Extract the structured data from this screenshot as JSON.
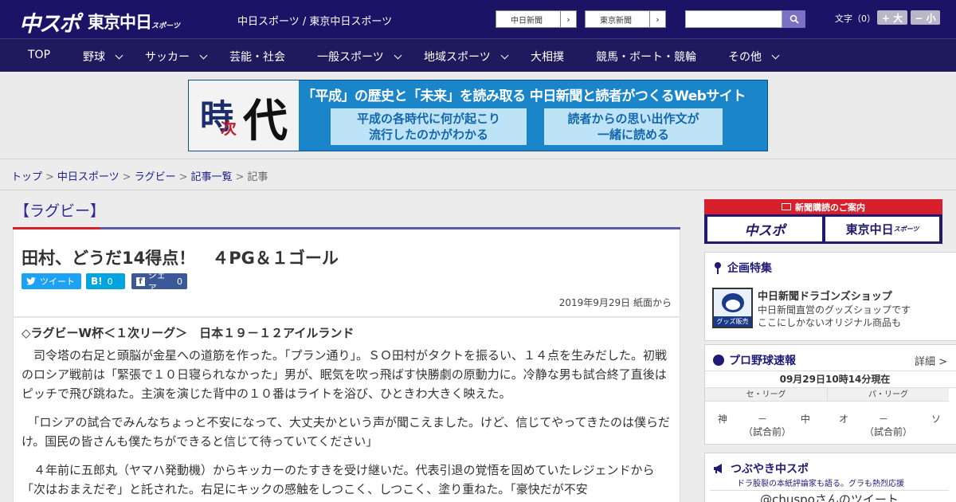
{
  "header": {
    "logo_chuspo": "中スポ",
    "logo_tokyo": "東京中日",
    "logo_tokyo_sub": "スポーツ",
    "tagline": "中日スポーツ / 東京中日スポーツ",
    "links": [
      {
        "label": "中日新聞",
        "arrow": "›"
      },
      {
        "label": "東京新聞",
        "arrow": "›"
      }
    ],
    "search_placeholder": "",
    "text_size_label": "文字（0）",
    "size_up": "+ 大",
    "size_down": "− 小"
  },
  "nav": {
    "items": [
      {
        "label": "TOP"
      },
      {
        "label": "野球"
      },
      {
        "label": "サッカー"
      },
      {
        "label": "芸能・社会"
      },
      {
        "label": "一般スポーツ"
      },
      {
        "label": "地域スポーツ"
      },
      {
        "label": "大相撲"
      },
      {
        "label": "競馬・ボート・競輪"
      },
      {
        "label": "その他"
      }
    ]
  },
  "banner": {
    "logo_chars": [
      "時",
      "次",
      "代"
    ],
    "title": "「平成」の歴史と「未来」を読み取る 中日新聞と読者がつくるWebサイト",
    "box1_line1": "平成の各時代に何が起こり",
    "box1_line2": "流行したのかがわかる",
    "box2_line1": "読者からの思い出作文が",
    "box2_line2": "一緒に読める"
  },
  "breadcrumb": {
    "items": [
      "トップ",
      "中日スポーツ",
      "ラグビー",
      "記事一覧"
    ],
    "current": "記事",
    "sep": ">"
  },
  "article": {
    "category": "【ラグビー】",
    "headline": "田村、どうだ14得点！　４PG＆１ゴール",
    "share": {
      "tweet": "ツイート",
      "hatena": "B!",
      "hatena_count": "0",
      "facebook": "シェア",
      "facebook_count": "0"
    },
    "date": "2019年9月29日 紙面から",
    "subhead": "◇ラグビーW杯＜１次リーグ＞　日本１９－１２アイルランド",
    "paragraphs": [
      "　司令塔の右足と頭脳が金星への道筋を作った。「プラン通り」。ＳＯ田村がタクトを振るい、１４点を生みだした。初戦のロシア戦前は「緊張で１０日寝られなかった」男が、眠気を吹っ飛ばす快勝劇の原動力に。冷静な男も試合終了直後はピッチで飛び跳ねた。主演を演じた背中の１０番はライトを浴び、ひときわ大きく映えた。",
      "　「ロシアの試合でみんなちょっと不安になって、大丈夫かという声が聞こえました。けど、信じてやってきたのは僕らだけ。国民の皆さんも僕たちができると信じて待っていてください」",
      "　４年前に五郎丸（ヤマハ発動機）からキッカーのたすきを受け継いだ。代表引退の覚悟を固めていたレジェンドから「次はおまえだぞ」と託された。右足にキックの感触をしつこく、しつこく、塗り重ねた。「豪快だが不安"
    ]
  },
  "sidebar": {
    "subscribe": {
      "header": "新聞購読のご案内",
      "btn1": "中スポ",
      "btn2": "東京中日",
      "btn2_sub": "スポーツ"
    },
    "feature": {
      "title": "企画特集",
      "shop_name": "中日新聞ドラゴンズショップ",
      "shop_desc1": "中日新聞直営のグッズショップです",
      "shop_desc2": "ここにしかないオリジナル商品も",
      "shop_img_label": "グッズ販売中"
    },
    "baseball": {
      "title": "プロ野球速報",
      "detail": "詳細 >",
      "time": "09月29日10時14分現在",
      "central": "セ・リーグ",
      "pacific": "パ・リーグ",
      "central_home": "神",
      "central_dash": "－",
      "central_away": "中",
      "pacific_home": "オ",
      "pacific_dash": "－",
      "pacific_away": "ソ",
      "status": "（試合前）"
    },
    "tweet": {
      "title": "つぶやき中スポ",
      "sub": "ドラ股裂の本紙評論家も語る。グラも熱烈応援",
      "account": "@chuspoさんのツイート"
    }
  },
  "colors": {
    "header_bg": "#1b1466",
    "nav_bg": "#1f1a5e",
    "accent_red": "#d8202d",
    "twitter": "#1da1f2",
    "hatena": "#00a4de",
    "facebook": "#3b5998"
  }
}
